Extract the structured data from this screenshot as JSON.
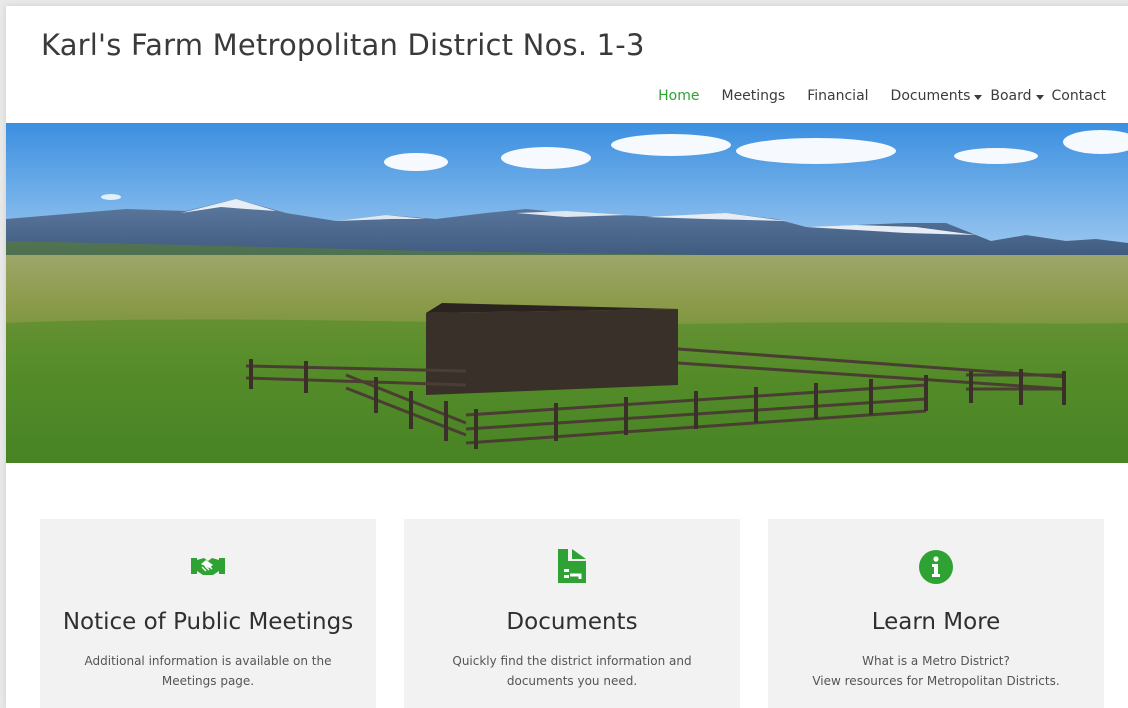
{
  "site": {
    "title": "Karl's Farm Metropolitan District Nos. 1-3"
  },
  "nav": {
    "items": [
      {
        "label": "Home",
        "active": true
      },
      {
        "label": "Meetings"
      },
      {
        "label": "Financial"
      },
      {
        "label": "Documents",
        "dropdown": true
      },
      {
        "label": "Board",
        "dropdown": true
      },
      {
        "label": "Contact"
      }
    ]
  },
  "colors": {
    "accent": "#2ea233",
    "card_bg": "#f2f2f2",
    "title_text": "#3a3a3a"
  },
  "cards": [
    {
      "icon": "handshake-icon",
      "title": "Notice of Public Meetings",
      "lines": [
        "Additional information is available on the",
        "Meetings page."
      ]
    },
    {
      "icon": "document-icon",
      "title": "Documents",
      "lines": [
        "Quickly find the district information and",
        "documents you need."
      ]
    },
    {
      "icon": "info-icon",
      "title": "Learn More",
      "lines": [
        "What is a Metro District?",
        "View resources for Metropolitan Districts."
      ]
    }
  ]
}
